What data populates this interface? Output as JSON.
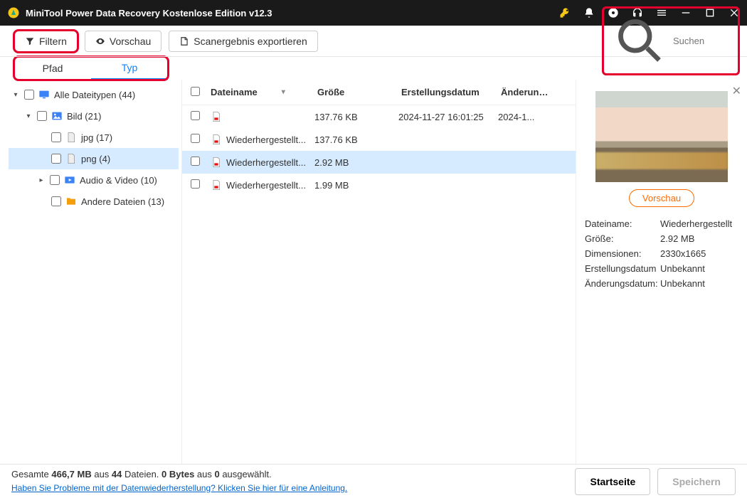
{
  "titlebar": {
    "title": "MiniTool Power Data Recovery Kostenlose Edition v12.3"
  },
  "toolbar": {
    "filter": "Filtern",
    "preview": "Vorschau",
    "export": "Scanergebnis exportieren",
    "search_placeholder": "Suchen"
  },
  "tabs": {
    "path": "Pfad",
    "type": "Typ"
  },
  "tree": {
    "all": "Alle Dateitypen (44)",
    "image": "Bild (21)",
    "jpg": "jpg (17)",
    "png": "png (4)",
    "av": "Audio & Video (10)",
    "other": "Andere Dateien (13)"
  },
  "columns": {
    "name": "Dateiname",
    "size": "Größe",
    "created": "Erstellungsdatum",
    "modified": "Änderungsd"
  },
  "rows": [
    {
      "name": "          ",
      "size": "137.76 KB",
      "created": "2024-11-27 16:01:25",
      "modified": "2024-1...",
      "blur": true,
      "sel": false
    },
    {
      "name": "Wiederhergestellt...",
      "size": "137.76 KB",
      "created": "",
      "modified": "",
      "blur": false,
      "sel": false
    },
    {
      "name": "Wiederhergestellt...",
      "size": "2.92 MB",
      "created": "",
      "modified": "",
      "blur": false,
      "sel": true
    },
    {
      "name": "Wiederhergestellt...",
      "size": "1.99 MB",
      "created": "",
      "modified": "",
      "blur": false,
      "sel": false
    }
  ],
  "detail": {
    "preview_btn": "Vorschau",
    "labels": {
      "name": "Dateiname:",
      "size": "Größe:",
      "dim": "Dimensionen:",
      "created": "Erstellungsdatum",
      "modified": "Änderungsdatum:"
    },
    "values": {
      "name": "Wiederhergestellt",
      "size": "2.92 MB",
      "dim": "2330x1665",
      "created": "Unbekannt",
      "modified": "Unbekannt"
    }
  },
  "footer": {
    "summary_pre": "Gesamte ",
    "summary_total": "466,7 MB",
    "summary_mid": " aus ",
    "summary_count": "44",
    "summary_post": " Dateien.  ",
    "sel_bytes": "0 Bytes",
    "sel_mid": " aus ",
    "sel_count": "0",
    "sel_post": " ausgewählt.",
    "help_link": "Haben Sie Probleme mit der Datenwiederherstellung? Klicken Sie hier für eine Anleitung.",
    "home": "Startseite",
    "save": "Speichern"
  }
}
